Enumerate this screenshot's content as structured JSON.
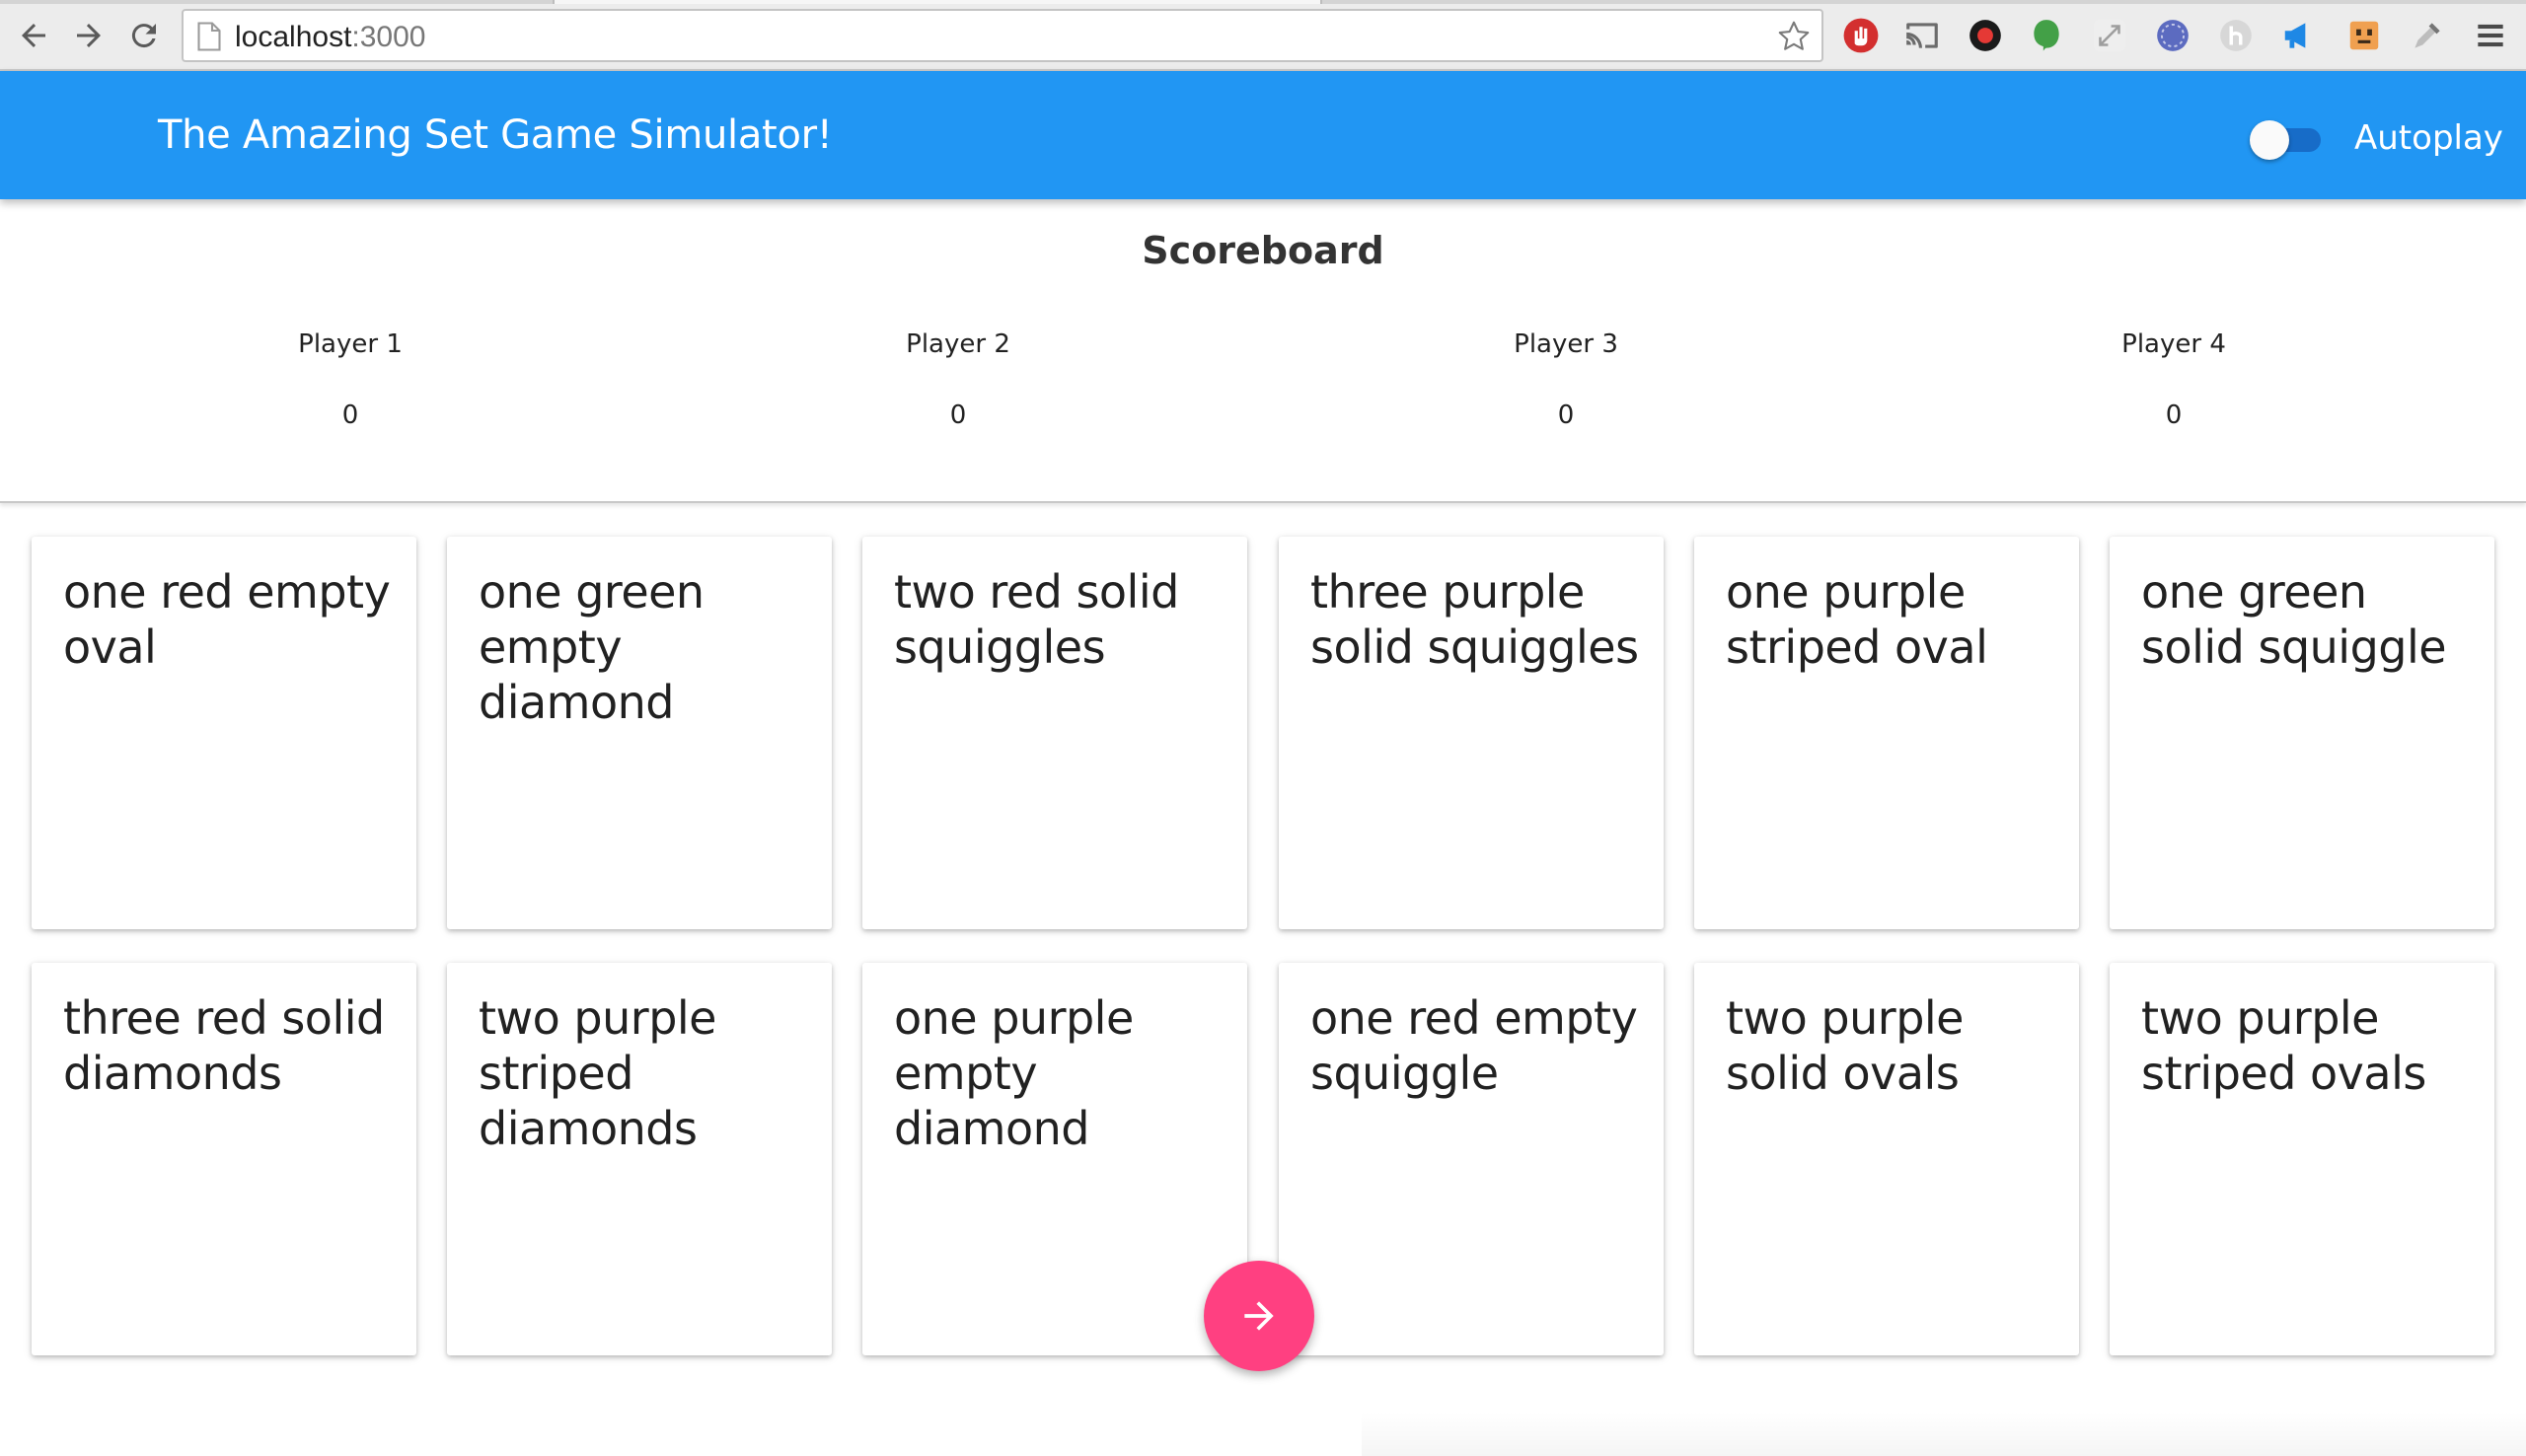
{
  "browser": {
    "url_host": "localhost",
    "url_port": ":3000",
    "extensions": [
      "stop-hand-icon",
      "cast-icon",
      "record-icon",
      "evernote-icon",
      "resize-icon",
      "ws-icon",
      "h-icon",
      "megaphone-icon",
      "robot-icon",
      "eyedropper-icon"
    ]
  },
  "appbar": {
    "title": "The Amazing Set Game Simulator!",
    "autoplay_label": "Autoplay",
    "autoplay_on": false,
    "color": "#2196f3"
  },
  "scoreboard": {
    "title": "Scoreboard",
    "players": [
      {
        "name": "Player 1",
        "score": "0"
      },
      {
        "name": "Player 2",
        "score": "0"
      },
      {
        "name": "Player 3",
        "score": "0"
      },
      {
        "name": "Player 4",
        "score": "0"
      }
    ]
  },
  "cards": [
    "one red empty oval",
    "one green empty diamond",
    "two red solid squiggles",
    "three purple solid squiggles",
    "one purple striped oval",
    "one green solid squiggle",
    "three red solid diamonds",
    "two purple striped diamonds",
    "one purple empty diamond",
    "one red empty squiggle",
    "two purple solid ovals",
    "two purple striped ovals"
  ],
  "fab": {
    "icon": "arrow-right-icon",
    "color": "#ff4081"
  }
}
